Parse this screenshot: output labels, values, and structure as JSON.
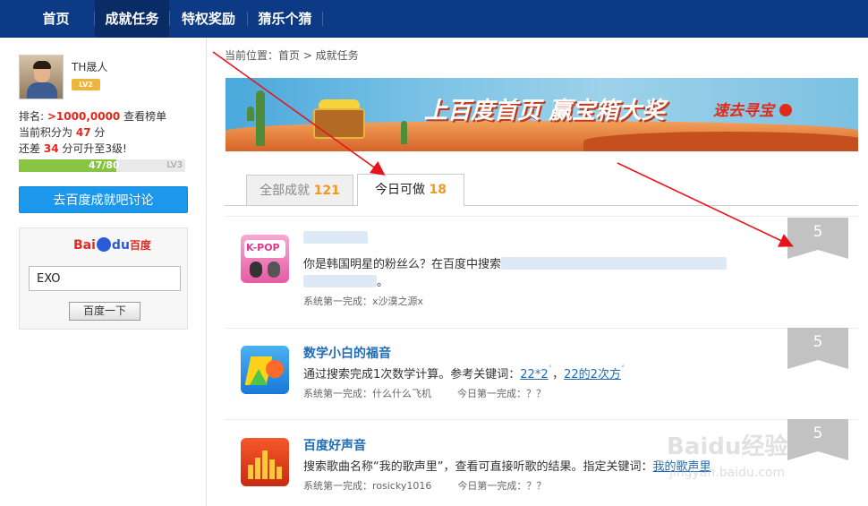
{
  "nav": {
    "items": [
      {
        "label": "首页"
      },
      {
        "label": "成就任务"
      },
      {
        "label": "特权奖励"
      },
      {
        "label": "猜乐个猜"
      }
    ]
  },
  "profile": {
    "username": "TH晟人",
    "level_badge": "LV2",
    "rank_label": "排名:",
    "rank_value": ">1000,0000",
    "rank_link": "查看榜单",
    "points_prefix": "当前积分为",
    "points_value": "47",
    "points_suffix": "分",
    "need_prefix": "还差",
    "need_value": "34",
    "need_suffix": "分可升至3级!",
    "progress_text": "47/80",
    "progress_fraction": 0.5875,
    "next_level": "LV3",
    "discuss_button": "去百度成就吧讨论"
  },
  "search": {
    "logo_text_1": "Bai",
    "logo_text_2": "du",
    "logo_text_3": "百度",
    "input_value": "EXO",
    "button_label": "百度一下"
  },
  "breadcrumb": "当前位置：首页 > 成就任务",
  "banner": {
    "headline": "上百度首页 赢宝箱大奖",
    "cta": "速去寻宝"
  },
  "tabs": [
    {
      "label": "全部成就",
      "count": "121"
    },
    {
      "label": "今日可做",
      "count": "18"
    }
  ],
  "tasks": [
    {
      "title": "",
      "icon_text": "K-POP",
      "desc": "你是韩国明星的粉丝么？在百度中搜索",
      "desc_end": "。",
      "first_label": "系统第一完成：",
      "first_value": "x沙漠之源x",
      "score": "5"
    },
    {
      "title": "数学小白的福音",
      "desc": "通过搜索完成1次数学计算。参考关键词：",
      "keyword1": "22*2",
      "keyword_sep": "，",
      "keyword2": "22的2次方",
      "first_label": "系统第一完成：",
      "first_value": "什么什么飞机",
      "today_label": "今日第一完成：",
      "today_value": "？？",
      "score": "5"
    },
    {
      "title": "百度好声音",
      "desc": "搜索歌曲名称“我的歌声里”，查看可直接听歌的结果。指定关键词：",
      "keyword1": "我的歌声里",
      "first_label": "系统第一完成：",
      "first_value": "rosicky1016",
      "today_label": "今日第一完成：",
      "today_value": "？？",
      "score": "5"
    }
  ],
  "watermark": {
    "main": "Baidu经验",
    "sub": "jingyan.baidu.com"
  },
  "colors": {
    "nav_bg": "#0d3a85",
    "accent_blue": "#1b97ec",
    "link_blue": "#1f6cb5",
    "highlight_red": "#e6251b",
    "count_orange": "#f39820",
    "annotation_red": "#e8141c"
  }
}
